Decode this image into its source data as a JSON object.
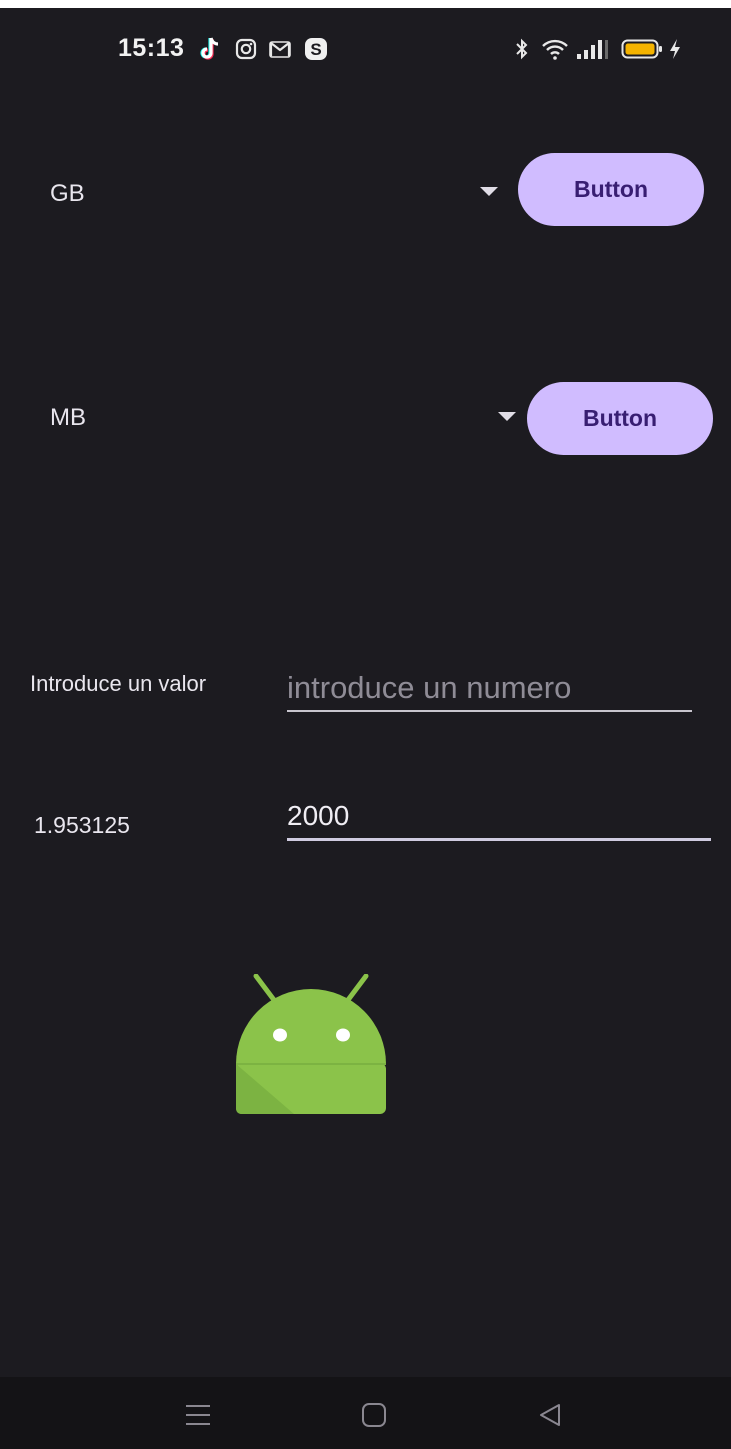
{
  "status_bar": {
    "time": "15:13",
    "left_icons": [
      "tiktok-icon",
      "instagram-icon",
      "gmail-icon",
      "skype-icon"
    ],
    "right_icons": [
      "bluetooth-icon",
      "wifi-icon",
      "signal-icon",
      "battery-icon",
      "charging-icon"
    ],
    "battery_color": "#f5b400"
  },
  "spinner_top": {
    "selected": "GB",
    "button_label": "Button"
  },
  "spinner_bottom": {
    "selected": "MB",
    "button_label": "Button"
  },
  "input_row": {
    "label": "Introduce un valor",
    "placeholder": "introduce un numero"
  },
  "result_row": {
    "result": "1.953125",
    "value": "2000"
  },
  "nav_bar": {
    "icons": [
      "menu-icon",
      "home-icon",
      "back-icon"
    ]
  },
  "colors": {
    "background": "#1c1b20",
    "button_bg": "#d0bcff",
    "button_text": "#381e72",
    "android_green": "#8bc34a"
  }
}
